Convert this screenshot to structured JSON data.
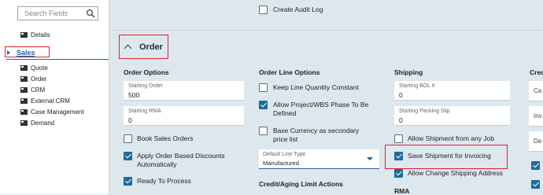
{
  "sidebar": {
    "search_placeholder": "Search Fields",
    "items": [
      {
        "label": "Details"
      },
      {
        "label": "Sales"
      },
      {
        "label": "Quote"
      },
      {
        "label": "Order"
      },
      {
        "label": "CRM"
      },
      {
        "label": "External CRM"
      },
      {
        "label": "Case Management"
      },
      {
        "label": "Demand"
      }
    ]
  },
  "top": {
    "audit_log": {
      "label": "Create Audit Log",
      "checked": false
    }
  },
  "section": {
    "title": "Order"
  },
  "order_options": {
    "heading": "Order Options",
    "starting_order": {
      "label": "Starting Order",
      "value": "500"
    },
    "starting_rma": {
      "label": "Starting RMA",
      "value": "0"
    },
    "book_sales_orders": {
      "label": "Book Sales Orders",
      "checked": false
    },
    "apply_discounts": {
      "label": "Apply Order Based Discounts Automatically",
      "checked": true
    },
    "ready_to_process": {
      "label": "Ready To Process",
      "checked": true
    }
  },
  "line_options": {
    "heading": "Order Line Options",
    "keep_qty": {
      "label": "Keep Line Quantity Constant",
      "checked": false
    },
    "allow_project": {
      "label": "Allow Project/WBS Phase To Be Defined",
      "checked": true
    },
    "base_currency": {
      "label": "Base Currency as secondary price list",
      "checked": false
    },
    "default_line_type": {
      "label": "Default Line Type",
      "value": "Manufactured"
    },
    "credit_heading": "Credit/Aging Limit Actions"
  },
  "shipping": {
    "heading": "Shipping",
    "starting_bol": {
      "label": "Starting BOL #",
      "value": "0"
    },
    "starting_slip": {
      "label": "Starting Packing Slip",
      "value": "0"
    },
    "allow_any_job": {
      "label": "Allow Shipment from any Job",
      "checked": false
    },
    "save_for_invoicing": {
      "label": "Save Shipment for Invoicing",
      "checked": true
    },
    "allow_change_address": {
      "label": "Allow Change Shipping Address",
      "checked": true
    },
    "rma_heading": "RMA"
  },
  "edge_column": {
    "heading": "Cred",
    "field1": "Ca",
    "field2": "Inv",
    "field3": "De"
  },
  "colors": {
    "accent": "#1f6b9a",
    "highlight": "#e2222e",
    "panel": "#dde7ee"
  }
}
